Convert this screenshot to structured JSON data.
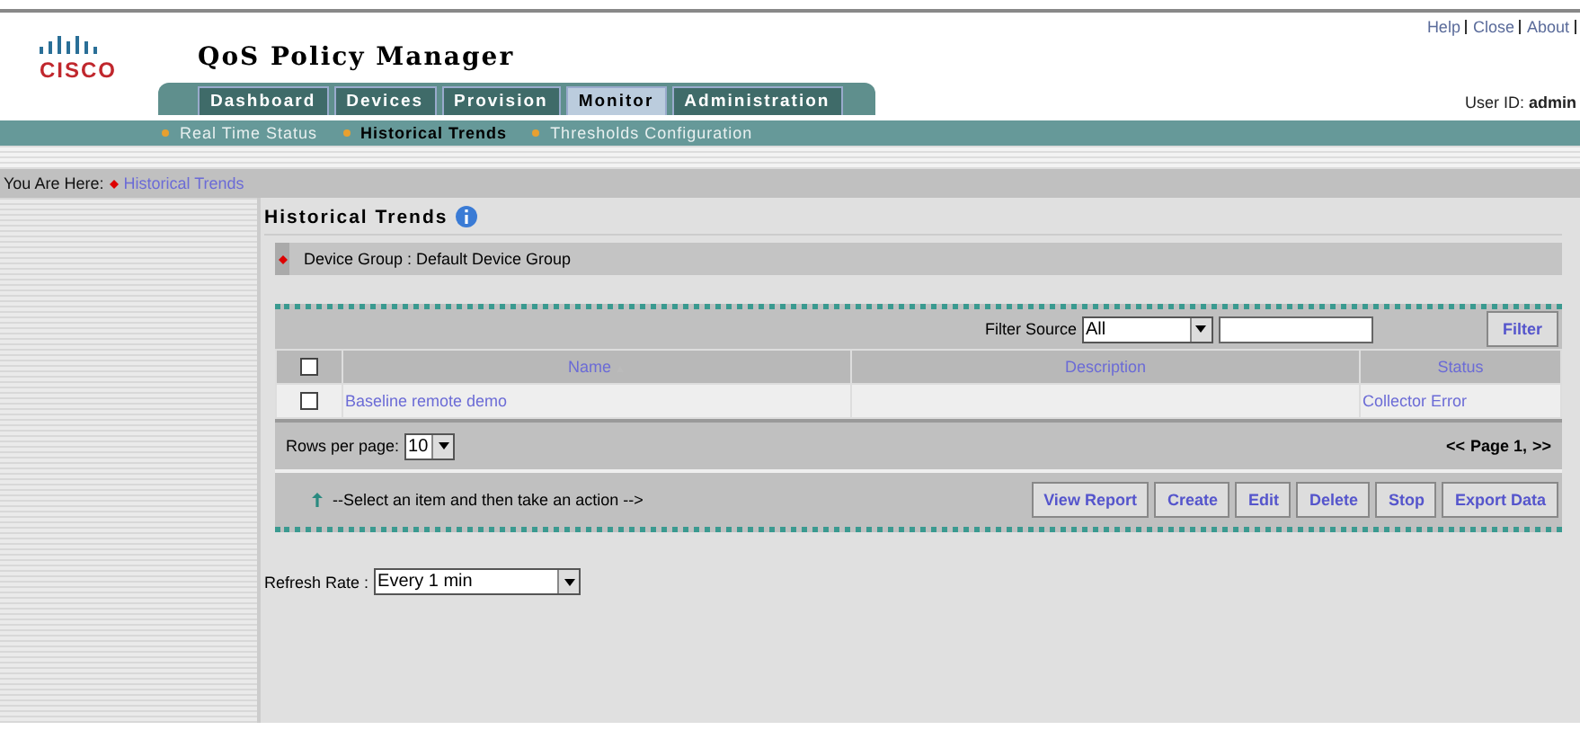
{
  "header": {
    "logo_text": "CISCO",
    "title": "QoS Policy Manager",
    "links": [
      "Help",
      "Close",
      "About"
    ],
    "user_label": "User ID:",
    "user": "admin"
  },
  "tabs": [
    {
      "label": "Dashboard",
      "selected": false
    },
    {
      "label": "Devices",
      "selected": false
    },
    {
      "label": "Provision",
      "selected": false
    },
    {
      "label": "Monitor",
      "selected": true
    },
    {
      "label": "Administration",
      "selected": false
    }
  ],
  "subnav": [
    {
      "label": "Real Time Status",
      "selected": false
    },
    {
      "label": "Historical Trends",
      "selected": true
    },
    {
      "label": "Thresholds Configuration",
      "selected": false
    }
  ],
  "breadcrumb": {
    "label": "You Are Here:",
    "item": "Historical Trends"
  },
  "page_title": "Historical Trends",
  "device_group": "Device Group : Default Device Group",
  "filter": {
    "label": "Filter Source",
    "value": "All",
    "button": "Filter"
  },
  "table": {
    "header_checked": false,
    "columns": [
      "Name",
      "Description",
      "Status"
    ],
    "rows": [
      {
        "checked": false,
        "name": "Baseline remote demo",
        "description": "",
        "status": "Collector Error"
      }
    ]
  },
  "rows_per_page": {
    "label": "Rows per page:",
    "value": "10"
  },
  "pager": {
    "prev": "<<",
    "page": "Page 1,",
    "next": ">>"
  },
  "action_hint": "--Select an item and then take an action -->",
  "actions": [
    "View Report",
    "Create",
    "Edit",
    "Delete",
    "Stop",
    "Export Data"
  ],
  "refresh": {
    "label": "Refresh Rate :",
    "value": "Every 1 min"
  }
}
